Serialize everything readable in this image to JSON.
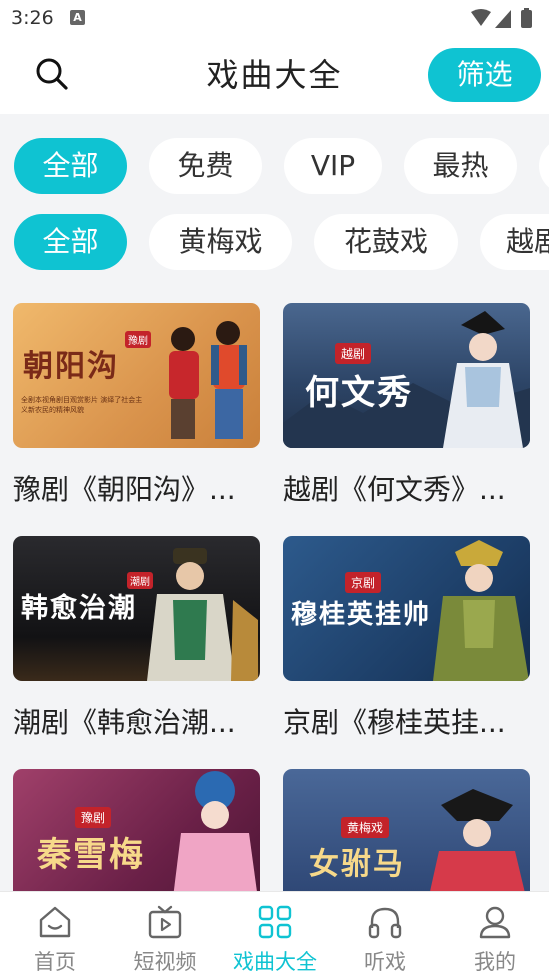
{
  "status": {
    "time": "3:26",
    "notif": "A"
  },
  "header": {
    "title": "戏曲大全",
    "filter_label": "筛选"
  },
  "filters_row1": [
    {
      "label": "全部",
      "active": true
    },
    {
      "label": "免费",
      "active": false
    },
    {
      "label": "VIP",
      "active": false
    },
    {
      "label": "最热",
      "active": false
    },
    {
      "label": "",
      "active": false
    }
  ],
  "filters_row2": [
    {
      "label": "全部",
      "active": true
    },
    {
      "label": "黄梅戏",
      "active": false
    },
    {
      "label": "花鼓戏",
      "active": false
    },
    {
      "label": "越剧",
      "active": false
    }
  ],
  "cards": [
    {
      "title": "豫剧《朝阳沟》...",
      "art": "朝阳沟",
      "badge": "豫剧",
      "caption": "全剧本视角剧目观赏影片 演绎了社会主义新农民的精神风貌",
      "bg": "#e2a15b"
    },
    {
      "title": "越剧《何文秀》...",
      "art": "何文秀",
      "badge": "越剧",
      "bg": "#2e4667"
    },
    {
      "title": "潮剧《韩愈治潮...",
      "art": "韩愈治潮",
      "badge": "潮剧",
      "bg": "#1b1a1c"
    },
    {
      "title": "京剧《穆桂英挂...",
      "art": "穆桂英挂帅",
      "badge": "京剧",
      "bg": "#1f4670"
    },
    {
      "title": "",
      "art": "秦雪梅",
      "badge": "豫剧",
      "bg": "#7a2a4d"
    },
    {
      "title": "",
      "art": "女驸马",
      "badge": "黄梅戏",
      "bg": "#35507a"
    }
  ],
  "tabs": [
    {
      "label": "首页",
      "icon": "home-icon",
      "active": false
    },
    {
      "label": "短视频",
      "icon": "video-icon",
      "active": false
    },
    {
      "label": "戏曲大全",
      "icon": "grid-icon",
      "active": true
    },
    {
      "label": "听戏",
      "icon": "headphones-icon",
      "active": false
    },
    {
      "label": "我的",
      "icon": "user-icon",
      "active": false
    }
  ],
  "colors": {
    "accent": "#0fc3d2",
    "inactive_tab": "#888888",
    "background": "#f3f4f6"
  }
}
